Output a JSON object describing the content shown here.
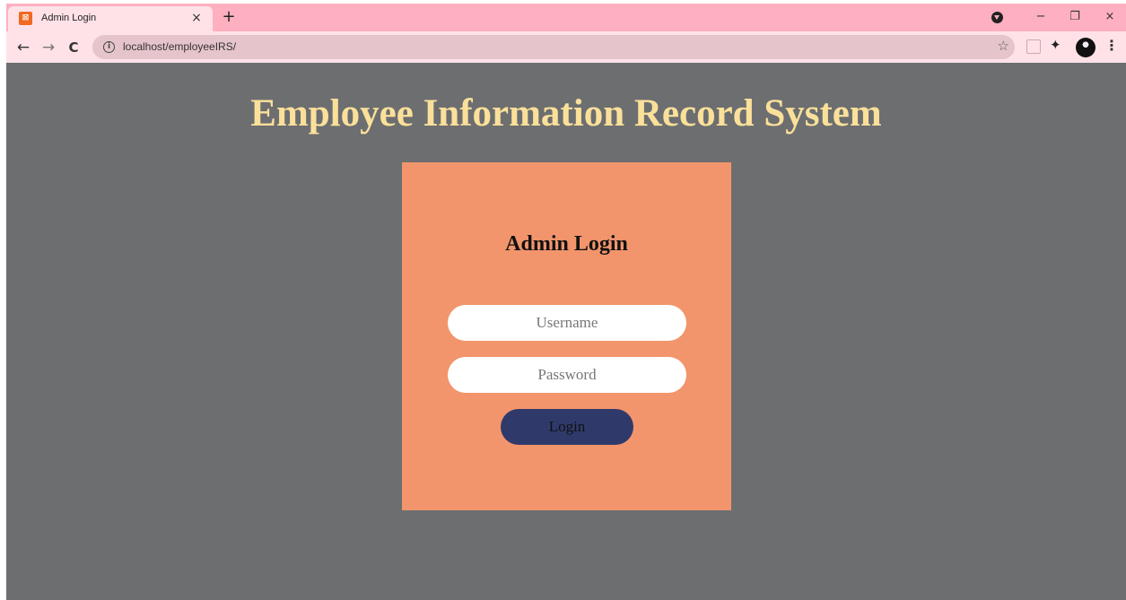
{
  "browser": {
    "tab_title": "Admin Login",
    "tab_close": "×",
    "new_tab": "+",
    "url": "localhost/employeeIRS/",
    "back": "←",
    "forward": "→",
    "reload": "C",
    "info": "i",
    "bookmark": "☆",
    "window_minimize": "−",
    "window_restore": "❐",
    "window_close": "×",
    "menu": "⋮"
  },
  "page": {
    "heading": "Employee Information Record System",
    "login": {
      "title": "Admin Login",
      "username_placeholder": "Username",
      "password_placeholder": "Password",
      "button_label": "Login"
    }
  },
  "colors": {
    "page_background": "#6c6e70",
    "heading": "#fbe09a",
    "card": "#f2956c",
    "button": "#2f3a6b",
    "tab_strip": "#ffb0c0"
  }
}
